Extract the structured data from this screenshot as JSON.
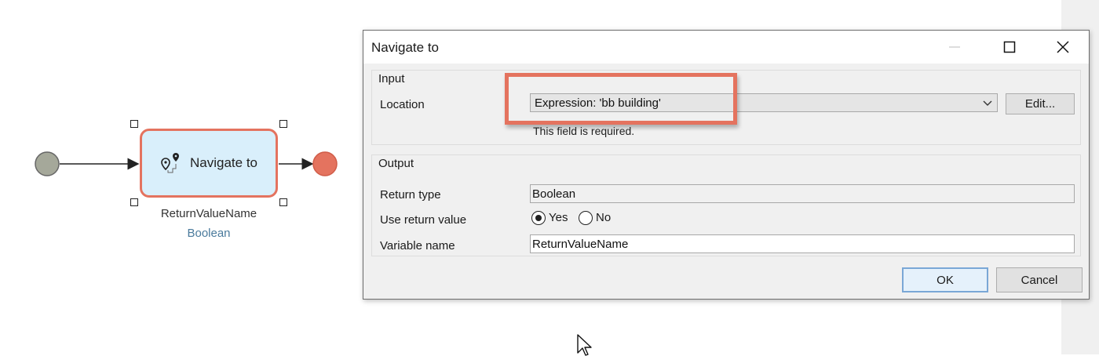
{
  "flow": {
    "activity_label": "Navigate to",
    "return_variable": "ReturnValueName",
    "return_type": "Boolean",
    "colors": {
      "start_event": "#a5a89a",
      "end_event": "#e4735f",
      "activity_fill": "#d9effb",
      "activity_border": "#e4735f",
      "type_text": "#4a7a9c"
    }
  },
  "dialog": {
    "title": "Navigate to",
    "window_controls": [
      "minimize-icon",
      "maximize-icon",
      "close-icon"
    ],
    "input_group": {
      "title": "Input",
      "location_label": "Location",
      "location_value": "Expression: 'bb building'",
      "edit_button": "Edit...",
      "validation_message": "This field is required."
    },
    "output_group": {
      "title": "Output",
      "return_type_label": "Return type",
      "return_type_value": "Boolean",
      "use_return_label": "Use return value",
      "yes_label": "Yes",
      "no_label": "No",
      "selected": "Yes",
      "variable_name_label": "Variable name",
      "variable_name_value": "ReturnValueName"
    },
    "ok_button": "OK",
    "cancel_button": "Cancel",
    "highlight_color": "#e4735f"
  }
}
